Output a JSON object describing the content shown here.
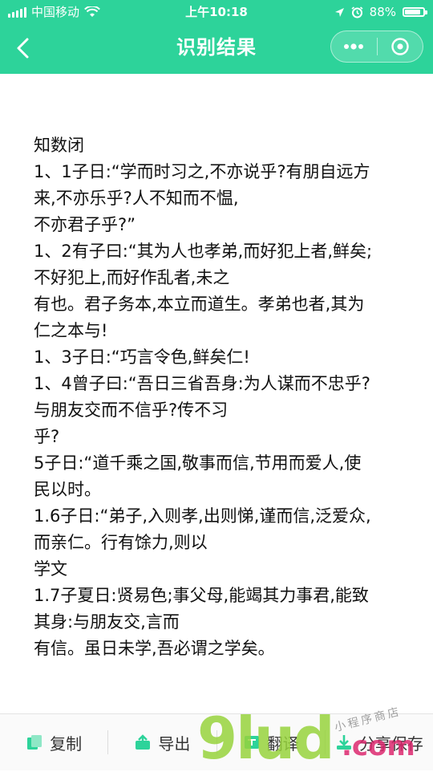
{
  "statusbar": {
    "carrier": "中国移动",
    "time": "上午10:18",
    "battery_text": "88%",
    "battery_level": 0.88
  },
  "navbar": {
    "title": "识别结果"
  },
  "content": {
    "lines": [
      "知数闭",
      "1、1子日:“学而时习之,不亦说乎?有朋自远方",
      "来,不亦乐乎?人不知而不愠,",
      "不亦君子乎?”",
      "1、2有子曰:“其为人也孝弟,而好犯上者,鲜矣;",
      "不好犯上,而好作乱者,未之",
      "有也。君子务本,本立而道生。孝弟也者,其为",
      "仁之本与!",
      "1、3子日:“巧言令色,鲜矣仁!",
      "1、4曾子曰:“吾日三省吾身:为人谋而不忠乎?",
      "与朋友交而不信乎?传不习",
      "乎?",
      "5子日:“道千乘之国,敬事而信,节用而爱人,使",
      "民以时。",
      "1.6子日:“弟子,入则孝,出则悌,谨而信,泛爱众,",
      "而亲仁。行有馀力,则以",
      "学文",
      "1.7子夏日:贤易色;事父母,能竭其力事君,能致",
      "其身:与朋友交,言而",
      "有信。虽日未学,吾必谓之学矣。"
    ]
  },
  "bottombar": {
    "copy_label": "复制",
    "export_label": "导出",
    "translate_label": "翻译",
    "share_save_label": "分享保存"
  },
  "watermark": {
    "main": "9lud",
    "com": ".com",
    "shop": "小程序商店"
  },
  "colors": {
    "accent": "#2dd39a",
    "icon_green": "#2dd39a"
  }
}
